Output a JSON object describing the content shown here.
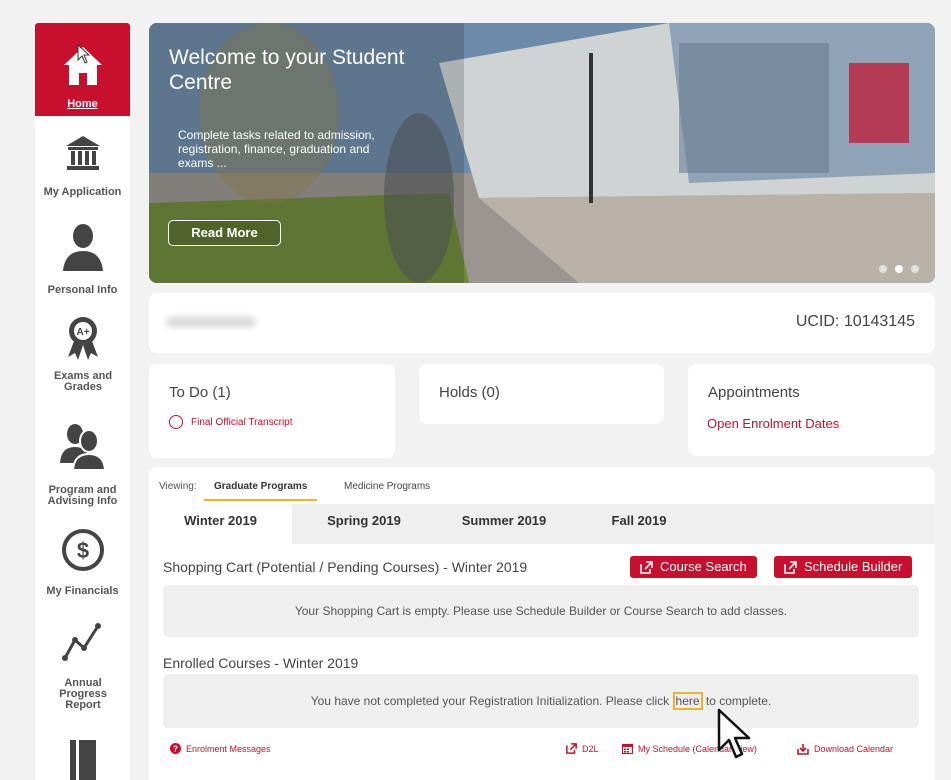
{
  "sidebar": {
    "items": [
      {
        "label": "Home",
        "icon": "home-icon"
      },
      {
        "label": "My Application",
        "icon": "institution-icon"
      },
      {
        "label": "Personal Info",
        "icon": "person-icon"
      },
      {
        "label": "Exams and Grades",
        "icon": "award-icon"
      },
      {
        "label": "Program and Advising Info",
        "icon": "advising-icon"
      },
      {
        "label": "My Financials",
        "icon": "dollar-icon"
      },
      {
        "label": "Annual Progress Report",
        "icon": "chart-line-icon"
      },
      {
        "label": "",
        "icon": "book-icon"
      }
    ]
  },
  "hero": {
    "title": "Welcome to your Student Centre",
    "description": "Complete tasks related to admission, registration, finance, graduation and exams ...",
    "button": "Read More"
  },
  "profile": {
    "ucid": "UCID: 10143145"
  },
  "todo": {
    "title": "To Do (1)",
    "item": "Final Official Transcript"
  },
  "holds": {
    "title": "Holds (0)"
  },
  "appointments": {
    "title": "Appointments",
    "link": "Open Enrolment Dates"
  },
  "programs": {
    "viewing_label": "Viewing:",
    "tabs": [
      "Graduate Programs",
      "Medicine Programs"
    ],
    "active": "Graduate Programs"
  },
  "terms": {
    "tabs": [
      "Winter 2019",
      "Spring 2019",
      "Summer 2019",
      "Fall 2019"
    ],
    "active": "Winter 2019"
  },
  "shopping_cart": {
    "title": "Shopping Cart (Potential / Pending Courses) - Winter 2019",
    "course_search": "Course Search",
    "schedule_builder": "Schedule Builder",
    "empty_message": "Your Shopping Cart is empty. Please use Schedule Builder or Course Search to add classes."
  },
  "enrolled": {
    "title": "Enrolled Courses - Winter 2019",
    "message_before": "You have not completed your Registration Initialization. Please click",
    "link": "here",
    "message_after": "to complete."
  },
  "footer": {
    "enrolment_messages": "Enrolment Messages",
    "d2l": "D2L",
    "my_schedule": "My Schedule (Calendar View)",
    "download_calendar": "Download Calendar"
  },
  "colors": {
    "brand_red": "#c8102e",
    "accent_gold": "#f0b323"
  }
}
